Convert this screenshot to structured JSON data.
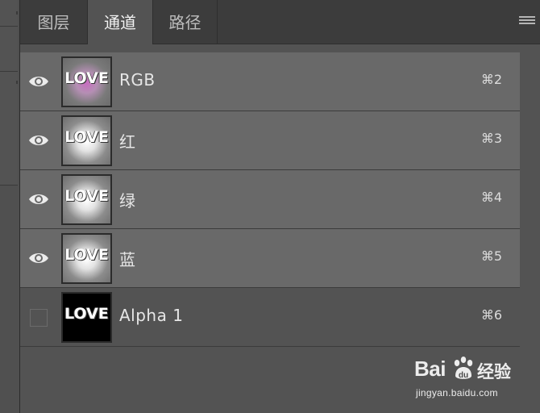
{
  "tabs": [
    {
      "label": "图层",
      "active": false
    },
    {
      "label": "通道",
      "active": true
    },
    {
      "label": "路径",
      "active": false
    }
  ],
  "panel_menu_icon": "hamburger-menu-icon",
  "channels": [
    {
      "name": "RGB",
      "shortcut": "⌘2",
      "visible": true,
      "selected": true,
      "thumb_text": "LOVE",
      "thumb_glow": "#c86cc0"
    },
    {
      "name": "红",
      "shortcut": "⌘3",
      "visible": true,
      "selected": true,
      "thumb_text": "LOVE",
      "thumb_glow": "#ffffff"
    },
    {
      "name": "绿",
      "shortcut": "⌘4",
      "visible": true,
      "selected": true,
      "thumb_text": "LOVE",
      "thumb_glow": "#ffffff"
    },
    {
      "name": "蓝",
      "shortcut": "⌘5",
      "visible": true,
      "selected": true,
      "thumb_text": "LOVE",
      "thumb_glow": "#ffffff"
    },
    {
      "name": "Alpha 1",
      "shortcut": "⌘6",
      "visible": false,
      "selected": false,
      "thumb_text": "LOVE",
      "thumb_glow": "#000000"
    }
  ],
  "watermark": {
    "logo": "Bai",
    "logo_cn": "经验",
    "url": "jingyan.baidu.com"
  },
  "colors": {
    "panel_bg": "#535353",
    "row_selected": "#696969",
    "tab_bar": "#3c3c3c",
    "text": "#e6e6e6"
  }
}
